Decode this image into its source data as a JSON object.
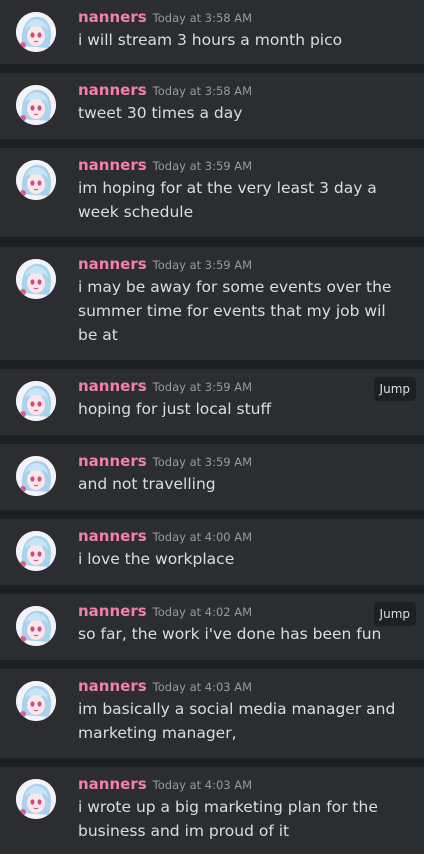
{
  "messages": [
    {
      "username": "nanners",
      "timestamp": "Today at 3:58 AM",
      "text": "i will stream 3 hours a month pico",
      "jump": ""
    },
    {
      "username": "nanners",
      "timestamp": "Today at 3:58 AM",
      "text": "tweet 30 times a day",
      "jump": ""
    },
    {
      "username": "nanners",
      "timestamp": "Today at 3:59 AM",
      "text": "im hoping for at the very least 3 day a week schedule",
      "jump": ""
    },
    {
      "username": "nanners",
      "timestamp": "Today at 3:59 AM",
      "text": "i may be away for some events over the summer time for events that my job wil be at",
      "jump": ""
    },
    {
      "username": "nanners",
      "timestamp": "Today at 3:59 AM",
      "text": "hoping for just local stuff",
      "jump": "Jump"
    },
    {
      "username": "nanners",
      "timestamp": "Today at 3:59 AM",
      "text": "and not travelling",
      "jump": ""
    },
    {
      "username": "nanners",
      "timestamp": "Today at 4:00 AM",
      "text": "i love the workplace",
      "jump": ""
    },
    {
      "username": "nanners",
      "timestamp": "Today at 4:02 AM",
      "text": "so far, the work i've done has been fun",
      "jump": "Jump"
    },
    {
      "username": "nanners",
      "timestamp": "Today at 4:03 AM",
      "text": "im basically a social media manager and marketing manager,",
      "jump": ""
    },
    {
      "username": "nanners",
      "timestamp": "Today at 4:03 AM",
      "text": "i wrote up a big marketing plan for the business and im proud of it",
      "jump": ""
    }
  ],
  "colors": {
    "background": "#1e1f22",
    "card": "#2b2d31",
    "username": "#f47fa8",
    "timestamp": "#949ba4",
    "text": "#dbdee1"
  },
  "avatar_icon": "anime-avatar-icon"
}
